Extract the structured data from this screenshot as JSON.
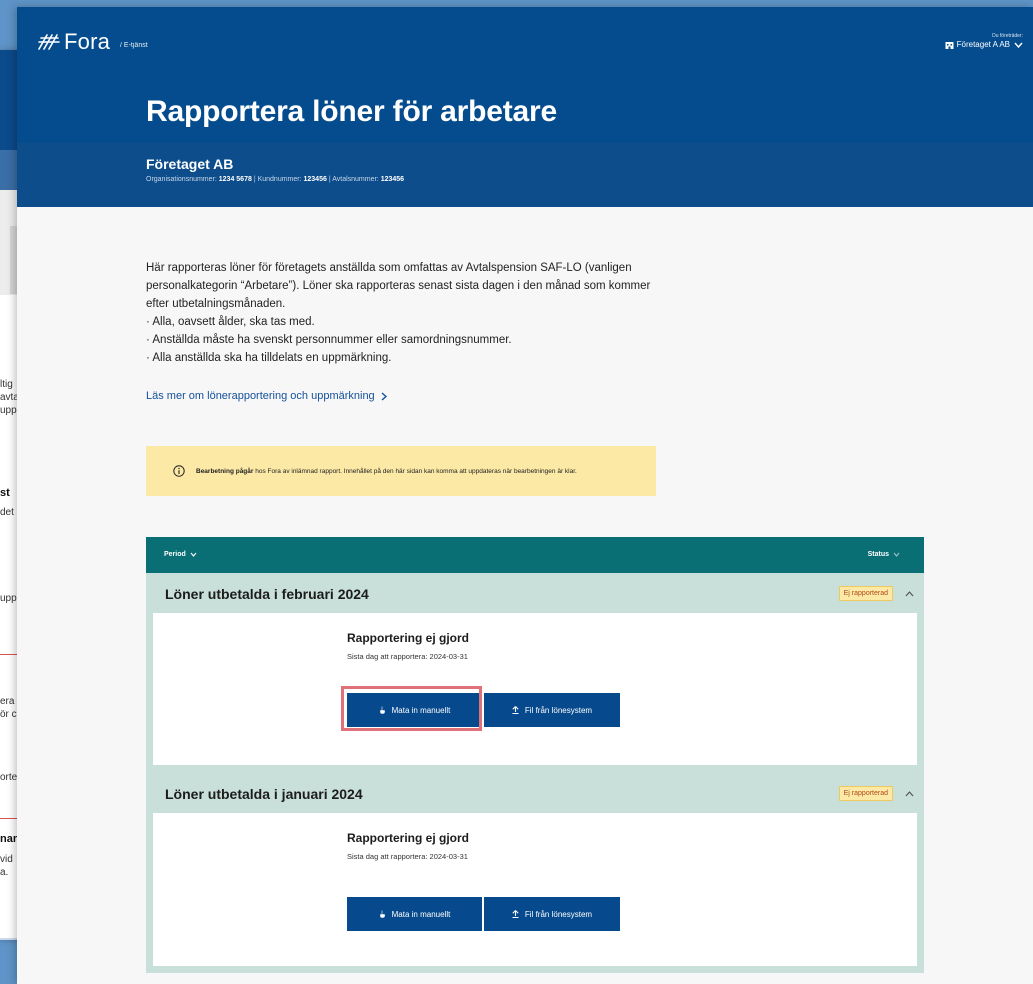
{
  "background_window": {
    "fragments": [
      "ltig",
      "avta",
      "upp",
      "st",
      "det",
      "upp",
      "era",
      "ör c",
      "orte",
      "nar",
      "vid",
      "a."
    ]
  },
  "header": {
    "logo_text": "Fora",
    "service_label": "/ E-tjänst",
    "user_caption": "Du företräder:",
    "company_selector": "Företaget A AB",
    "page_title": "Rapportera löner för arbetare"
  },
  "company": {
    "name": "Företaget AB",
    "org_label": "Organisationsnummer:",
    "org_number": "1234 5678",
    "customer_label": "Kundnummer:",
    "customer_number": "123456",
    "agreement_label": "Avtalsnummer:",
    "agreement_number": "123456"
  },
  "intro": {
    "text": "Här rapporteras löner för företagets anställda som omfattas av Avtalspension SAF-LO (vanligen personalkategorin “Arbetare”). Löner ska rapporteras senast sista dagen i den månad som kommer efter utbetalningsmånaden.",
    "bullets": [
      "· Alla, oavsett ålder, ska tas med.",
      "· Anställda måste ha svenskt personnummer eller samordningsnummer.",
      "· Alla anställda ska ha tilldelats en uppmärkning."
    ],
    "read_more": "Läs mer om lönerapportering och uppmärkning"
  },
  "notice": {
    "bold": "Bearbetning pågår",
    "text": " hos Fora av inlämnad rapport. Innehållet på den här sidan kan komma att uppdateras när bearbetningen är klar."
  },
  "table": {
    "period_header": "Period",
    "status_header": "Status"
  },
  "periods": [
    {
      "title": "Löner utbetalda i februari 2024",
      "status": "Ej rapporterad",
      "card_title": "Rapportering ej gjord",
      "deadline": "Sista dag att rapportera: 2024-03-31",
      "manual_button": "Mata in manuellt",
      "file_button": "Fil från lönesystem"
    },
    {
      "title": "Löner utbetalda i januari 2024",
      "status": "Ej rapporterad",
      "card_title": "Rapportering ej gjord",
      "deadline": "Sista dag att rapportera: 2024-03-31",
      "manual_button": "Mata in manuellt",
      "file_button": "Fil från lönesystem"
    }
  ],
  "colors": {
    "header_blue": "#054c8e",
    "table_header_teal": "#0a6f74",
    "section_mint": "#c9dfd9",
    "notice_yellow": "#fde9a6",
    "button_blue": "#064a8d",
    "highlight_red": "#e0707a"
  }
}
